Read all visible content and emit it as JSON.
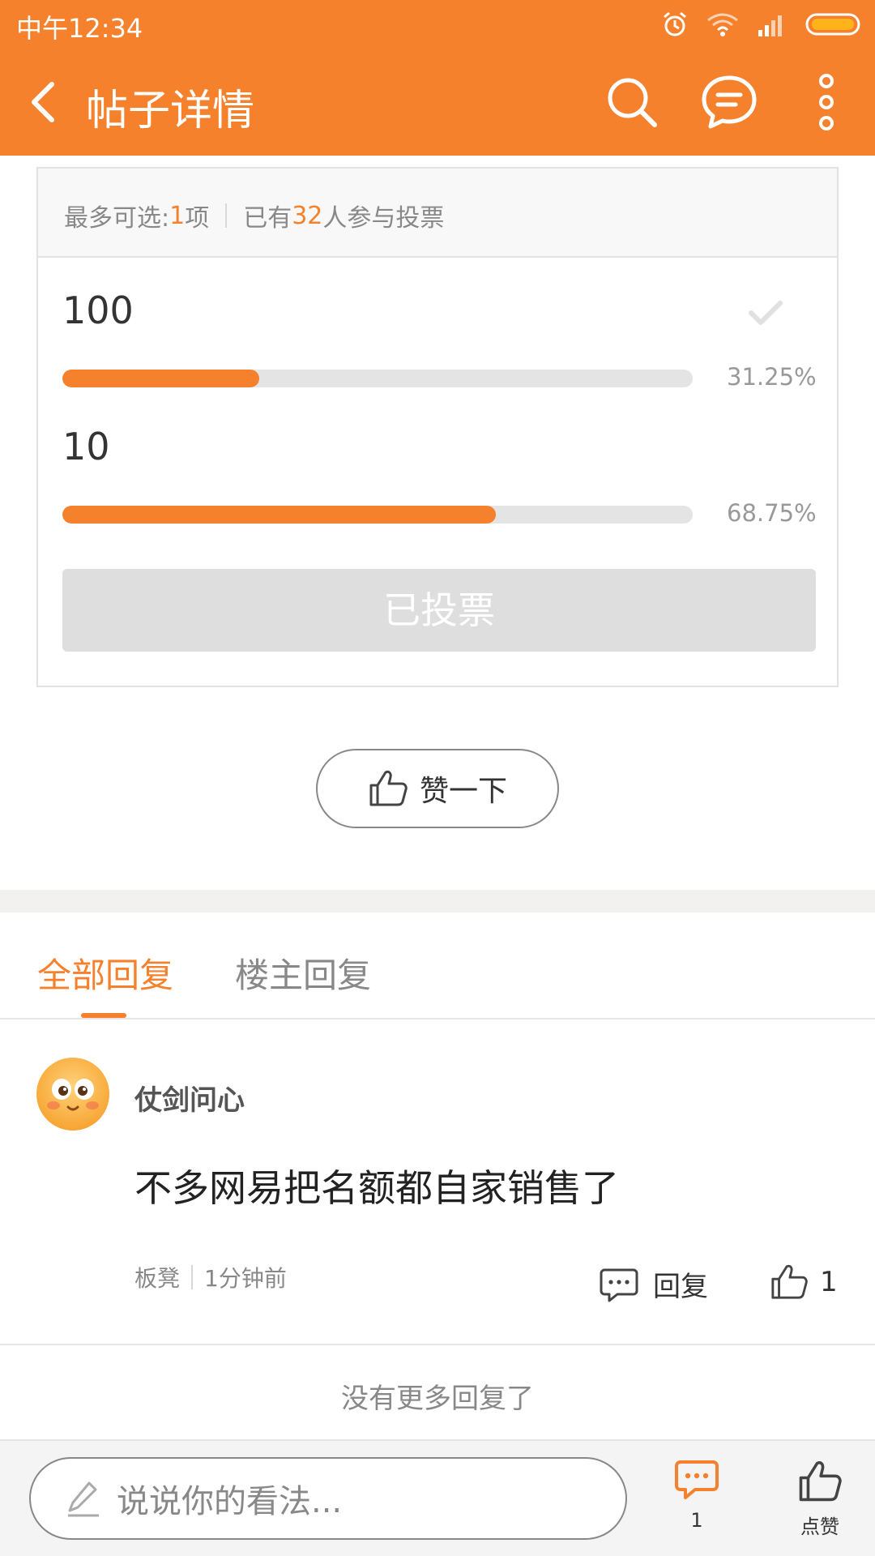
{
  "status_bar": {
    "time": "中午12:34",
    "icons": [
      "alarm-icon",
      "wifi-icon",
      "signal-icon",
      "battery-icon"
    ]
  },
  "app_bar": {
    "title": "帖子详情",
    "icons": [
      "back-arrow-icon",
      "search-icon",
      "message-icon",
      "more-vertical-icon"
    ],
    "color": "#f5812d"
  },
  "poll": {
    "header_prefix": "最多可选:",
    "max_choices": "1",
    "header_unit": "项",
    "participants_prefix": "已有",
    "participants_count": "32",
    "participants_suffix": "人参与投票",
    "options": [
      {
        "label": "100",
        "percent_text": "31.25%",
        "percent": 31.25,
        "selected": true
      },
      {
        "label": "10",
        "percent_text": "68.75%",
        "percent": 68.75,
        "selected": false
      }
    ],
    "voted_button_label": "已投票"
  },
  "like_button": {
    "label": "赞一下",
    "icon": "thumbs-up-icon"
  },
  "tabs": [
    {
      "label": "全部回复",
      "active": true
    },
    {
      "label": "楼主回复",
      "active": false
    }
  ],
  "replies": [
    {
      "username": "仗剑问心",
      "avatar": "emoji-face-avatar",
      "text": "不多网易把名额都自家销售了",
      "floor": "板凳",
      "time": "1分钟前",
      "reply_label": "回复",
      "like_count": "1"
    }
  ],
  "no_more_text": "没有更多回复了",
  "bottom_bar": {
    "input_placeholder": "说说你的看法...",
    "comment_count": "1",
    "like_label": "点赞"
  },
  "colors": {
    "accent": "#f5812d",
    "inactive": "#888888",
    "bar_track": "#e4e4e4"
  }
}
